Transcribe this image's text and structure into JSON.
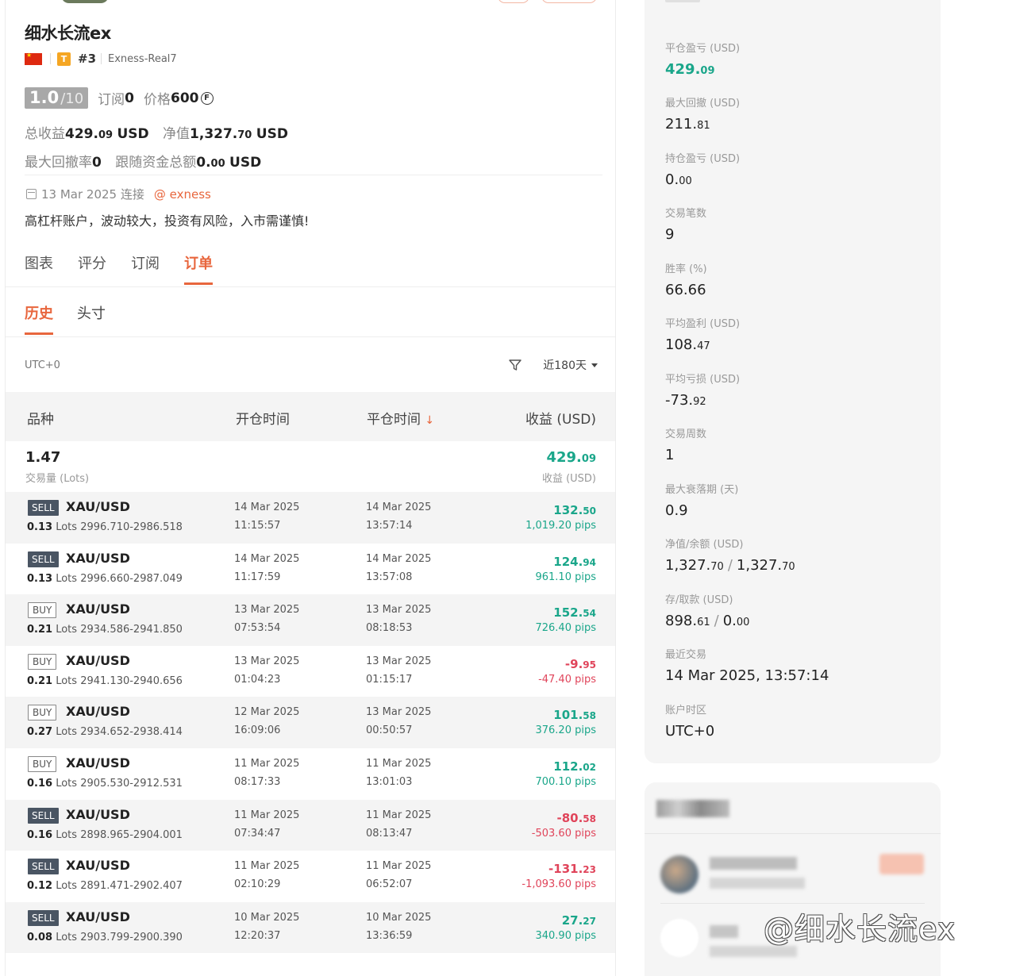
{
  "profile": {
    "name": "细水长流ex",
    "rank": "#3",
    "tier_badge": "T",
    "server": "Exness-Real7",
    "score": "1.0",
    "score_max": "/10",
    "subscribe_label": "订阅",
    "subscribe_value": "0",
    "price_label": "价格",
    "price_value": "600",
    "total_profit_label": "总收益",
    "total_profit_int": "429.",
    "total_profit_dec": "09",
    "total_profit_unit": "USD",
    "equity_label": "净值",
    "equity_int": "1,327.",
    "equity_dec": "70",
    "equity_unit": "USD",
    "max_dd_label": "最大回撤率",
    "max_dd_value": "0",
    "follow_label": "跟随资金总额",
    "follow_int": "0.",
    "follow_dec": "00",
    "follow_unit": "USD",
    "connect_date": "13 Mar 2025 连接",
    "broker": "@ exness",
    "description": "高杠杆账户，波动较大，投资有风险，入市需谨慎!"
  },
  "tabs": [
    "图表",
    "评分",
    "订阅",
    "订单"
  ],
  "active_tab": 3,
  "subtabs": [
    "历史",
    "头寸"
  ],
  "filter": {
    "timezone": "UTC+0",
    "range": "近180天"
  },
  "table": {
    "headers": {
      "symbol": "品种",
      "open_time": "开仓时间",
      "close_time": "平仓时间",
      "close_sort": "↓",
      "profit": "收益 (USD)"
    },
    "summary": {
      "lots": "1.47",
      "lots_label": "交易量 (Lots)",
      "profit_int": "429.",
      "profit_dec": "09",
      "profit_label": "收益 (USD)"
    },
    "rows": [
      {
        "side": "SELL",
        "symbol": "XAU/USD",
        "lots": "0.13",
        "lots_unit": "Lots",
        "prices": "2996.710-2986.518",
        "open_date": "14 Mar 2025",
        "open_time": "11:15:57",
        "close_date": "14 Mar 2025",
        "close_time": "13:57:14",
        "profit_int": "132.",
        "profit_dec": "50",
        "pips": "1,019.20 pips"
      },
      {
        "side": "SELL",
        "symbol": "XAU/USD",
        "lots": "0.13",
        "lots_unit": "Lots",
        "prices": "2996.660-2987.049",
        "open_date": "14 Mar 2025",
        "open_time": "11:17:59",
        "close_date": "14 Mar 2025",
        "close_time": "13:57:08",
        "profit_int": "124.",
        "profit_dec": "94",
        "pips": "961.10 pips"
      },
      {
        "side": "BUY",
        "symbol": "XAU/USD",
        "lots": "0.21",
        "lots_unit": "Lots",
        "prices": "2934.586-2941.850",
        "open_date": "13 Mar 2025",
        "open_time": "07:53:54",
        "close_date": "13 Mar 2025",
        "close_time": "08:18:53",
        "profit_int": "152.",
        "profit_dec": "54",
        "pips": "726.40 pips"
      },
      {
        "side": "BUY",
        "symbol": "XAU/USD",
        "lots": "0.21",
        "lots_unit": "Lots",
        "prices": "2941.130-2940.656",
        "open_date": "13 Mar 2025",
        "open_time": "01:04:23",
        "close_date": "13 Mar 2025",
        "close_time": "01:15:17",
        "profit_int": "-9.",
        "profit_dec": "95",
        "pips": "-47.40 pips"
      },
      {
        "side": "BUY",
        "symbol": "XAU/USD",
        "lots": "0.27",
        "lots_unit": "Lots",
        "prices": "2934.652-2938.414",
        "open_date": "12 Mar 2025",
        "open_time": "16:09:06",
        "close_date": "13 Mar 2025",
        "close_time": "00:50:57",
        "profit_int": "101.",
        "profit_dec": "58",
        "pips": "376.20 pips"
      },
      {
        "side": "BUY",
        "symbol": "XAU/USD",
        "lots": "0.16",
        "lots_unit": "Lots",
        "prices": "2905.530-2912.531",
        "open_date": "11 Mar 2025",
        "open_time": "08:17:33",
        "close_date": "11 Mar 2025",
        "close_time": "13:01:03",
        "profit_int": "112.",
        "profit_dec": "02",
        "pips": "700.10 pips"
      },
      {
        "side": "SELL",
        "symbol": "XAU/USD",
        "lots": "0.16",
        "lots_unit": "Lots",
        "prices": "2898.965-2904.001",
        "open_date": "11 Mar 2025",
        "open_time": "07:34:47",
        "close_date": "11 Mar 2025",
        "close_time": "08:13:47",
        "profit_int": "-80.",
        "profit_dec": "58",
        "pips": "-503.60 pips"
      },
      {
        "side": "SELL",
        "symbol": "XAU/USD",
        "lots": "0.12",
        "lots_unit": "Lots",
        "prices": "2891.471-2902.407",
        "open_date": "11 Mar 2025",
        "open_time": "02:10:29",
        "close_date": "11 Mar 2025",
        "close_time": "06:52:07",
        "profit_int": "-131.",
        "profit_dec": "23",
        "pips": "-1,093.60 pips"
      },
      {
        "side": "SELL",
        "symbol": "XAU/USD",
        "lots": "0.08",
        "lots_unit": "Lots",
        "prices": "2903.799-2900.390",
        "open_date": "10 Mar 2025",
        "open_time": "12:20:37",
        "close_date": "10 Mar 2025",
        "close_time": "13:36:59",
        "profit_int": "27.",
        "profit_dec": "27",
        "pips": "340.90 pips"
      }
    ]
  },
  "stats": {
    "closed_pnl_label": "平仓盈亏 (USD)",
    "closed_pnl_int": "429.",
    "closed_pnl_dec": "09",
    "max_dd_label": "最大回撤 (USD)",
    "max_dd_int": "211.",
    "max_dd_dec": "81",
    "open_pnl_label": "持仓盈亏 (USD)",
    "open_pnl_int": "0.",
    "open_pnl_dec": "00",
    "trades_label": "交易笔数",
    "trades_value": "9",
    "winrate_label": "胜率 (%)",
    "winrate_value": "66.66",
    "avg_win_label": "平均盈利 (USD)",
    "avg_win_int": "108.",
    "avg_win_dec": "47",
    "avg_loss_label": "平均亏损 (USD)",
    "avg_loss_int": "-73.",
    "avg_loss_dec": "92",
    "weeks_label": "交易周数",
    "weeks_value": "1",
    "max_dd_days_label": "最大衰落期 (天)",
    "max_dd_days_value": "0.9",
    "equity_balance_label": "净值/余额 (USD)",
    "equity_int": "1,327.",
    "equity_dec": "70",
    "balance_int": "1,327.",
    "balance_dec": "70",
    "deposit_label": "存/取款 (USD)",
    "deposit_int": "898.",
    "deposit_dec": "61",
    "withdraw_int": "0.",
    "withdraw_dec": "00",
    "last_trade_label": "最近交易",
    "last_trade_value": "14 Mar 2025, 13:57:14",
    "tz_label": "账户时区",
    "tz_value": "UTC+0",
    "slash": "/"
  },
  "watermark": "@细水长流ex",
  "colors": {
    "accent": "#e8663d",
    "profit": "#1aa68a",
    "loss": "#e0445a",
    "sell_badge": "#4a5563"
  }
}
